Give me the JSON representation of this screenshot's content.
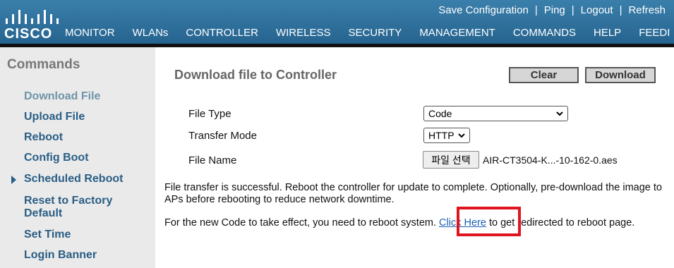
{
  "brand": {
    "logo_text": "CISCO"
  },
  "top_links": [
    {
      "label": "Save Configuration"
    },
    {
      "label": "Ping"
    },
    {
      "label": "Logout"
    },
    {
      "label": "Refresh"
    }
  ],
  "nav": [
    {
      "label": "MONITOR"
    },
    {
      "label": "WLANs"
    },
    {
      "label": "CONTROLLER"
    },
    {
      "label": "WIRELESS"
    },
    {
      "label": "SECURITY"
    },
    {
      "label": "MANAGEMENT"
    },
    {
      "label": "COMMANDS",
      "active": true
    },
    {
      "label": "HELP"
    },
    {
      "label": "FEEDI"
    }
  ],
  "sidebar": {
    "title": "Commands",
    "items": [
      {
        "label": "Download File",
        "current": true
      },
      {
        "label": "Upload File"
      },
      {
        "label": "Reboot"
      },
      {
        "label": "Config Boot"
      },
      {
        "label": "Scheduled Reboot",
        "expandable": true
      },
      {
        "label": "Reset to Factory Default"
      },
      {
        "label": "Set Time"
      },
      {
        "label": "Login Banner"
      }
    ]
  },
  "main": {
    "title": "Download file to Controller",
    "clear_label": "Clear",
    "download_label": "Download",
    "file_type": {
      "label": "File Type",
      "value": "Code"
    },
    "transfer_mode": {
      "label": "Transfer Mode",
      "value": "HTTP"
    },
    "file_name": {
      "label": "File Name",
      "button_label": "파일 선택",
      "value": "AIR-CT3504-K...-10-162-0.aes"
    },
    "message1": "File transfer is successful. Reboot the controller for update to complete. Optionally, pre-download the image to APs before rebooting to reduce network downtime.",
    "message2_before": "For the new Code to take effect, you need to reboot system.",
    "message2_link": "Click Here",
    "message2_after": "to get redirected to reboot page."
  },
  "colors": {
    "header": "#2b6f9e",
    "active_tab": "#e98a2a",
    "highlight": "#e0141e",
    "sidebar_link": "#2a5e85"
  }
}
